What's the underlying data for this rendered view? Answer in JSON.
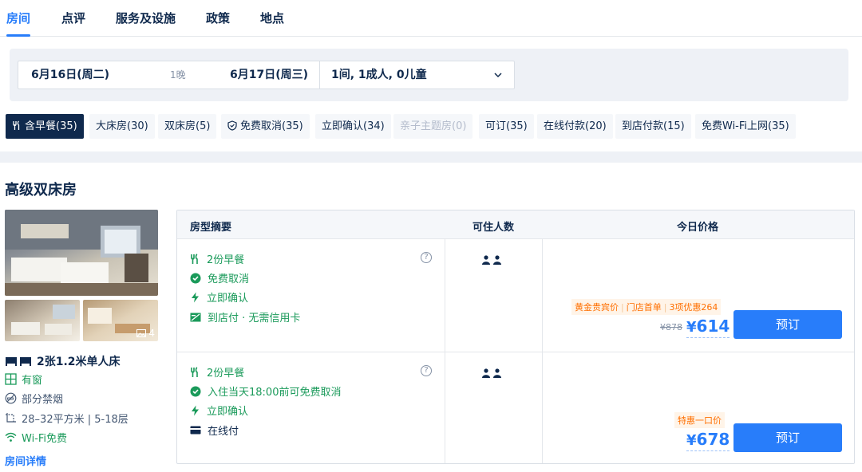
{
  "tabs": [
    "房间",
    "点评",
    "服务及设施",
    "政策",
    "地点"
  ],
  "search": {
    "checkin": "6月16日(周二)",
    "nights": "1晚",
    "checkout": "6月17日(周三)",
    "occupancy": "1间, 1成人, 0儿童"
  },
  "filters": [
    {
      "label": "含早餐(35)",
      "icon": "utensils-icon",
      "active": true
    },
    {
      "label": "大床房(30)"
    },
    {
      "label": "双床房(5)"
    },
    {
      "label": "免费取消(35)",
      "icon": "shield-check-icon"
    },
    {
      "label": "立即确认(34)"
    },
    {
      "label": "亲子主题房(0)",
      "disabled": true
    },
    {
      "label": "可订(35)"
    },
    {
      "label": "在线付款(20)"
    },
    {
      "label": "到店付款(15)"
    },
    {
      "label": "免费Wi-Fi上网(35)"
    }
  ],
  "room": {
    "title": "高级双床房",
    "photo_count": "4",
    "bed": "2张1.2米单人床",
    "features": [
      {
        "icon": "window-icon",
        "text": "有窗"
      },
      {
        "icon": "no-smoking-icon",
        "text": "部分禁烟"
      },
      {
        "icon": "area-icon",
        "text": "28–32平方米 | 5-18层"
      },
      {
        "icon": "wifi-icon",
        "text": "Wi-Fi免费"
      }
    ],
    "detail_link": "房间详情"
  },
  "table": {
    "headers": [
      "房型摘要",
      "可住人数",
      "今日价格"
    ],
    "rows": [
      {
        "items": [
          {
            "icon": "utensils-icon",
            "text": "2份早餐"
          },
          {
            "icon": "check-circle-icon",
            "text": "免费取消"
          },
          {
            "icon": "bolt-icon",
            "text": "立即确认"
          },
          {
            "icon": "pay-at-hotel-icon",
            "text": "到店付 · 无需信用卡"
          }
        ],
        "tags": [
          "黄金贵宾价",
          "门店首单",
          "3项优惠264"
        ],
        "original_price": "¥878",
        "price": "614",
        "currency": "¥",
        "button": "预订"
      },
      {
        "items": [
          {
            "icon": "utensils-icon",
            "text": "2份早餐"
          },
          {
            "icon": "check-circle-icon",
            "text": "入住当天18:00前可免费取消"
          },
          {
            "icon": "bolt-icon",
            "text": "立即确认"
          },
          {
            "icon": "card-icon",
            "text": "在线付"
          }
        ],
        "tags": [
          "特惠一口价"
        ],
        "price": "678",
        "currency": "¥",
        "button": "预订"
      }
    ]
  },
  "colors": {
    "accent": "#287dfa",
    "green": "#1a9a5a",
    "orange": "#ff6f00",
    "navy": "#0f294d"
  }
}
